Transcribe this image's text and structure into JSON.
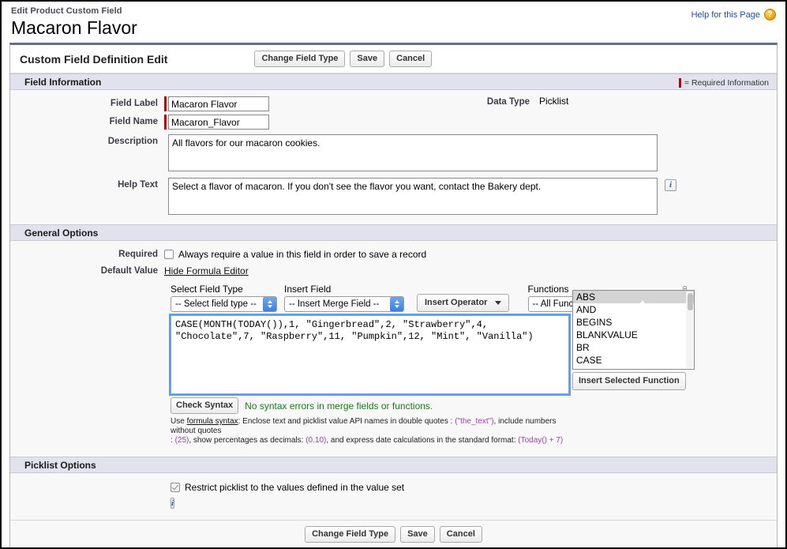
{
  "masthead": {
    "breadcrumb": "Edit Product Custom Field",
    "title": "Macaron Flavor",
    "help_link": "Help for this Page",
    "help_badge": "?"
  },
  "panel": {
    "title": "Custom Field Definition Edit",
    "buttons": {
      "change_field_type": "Change Field Type",
      "save": "Save",
      "cancel": "Cancel"
    }
  },
  "field_information": {
    "section_title": "Field Information",
    "required_legend": "= Required Information",
    "field_label": {
      "label": "Field Label",
      "value": "Macaron Flavor"
    },
    "field_name": {
      "label": "Field Name",
      "value": "Macaron_Flavor"
    },
    "description": {
      "label": "Description",
      "value": "All flavors for our macaron cookies."
    },
    "help_text": {
      "label": "Help Text",
      "value": "Select a flavor of macaron. If you don't see the flavor you want, contact the Bakery dept."
    },
    "data_type": {
      "label": "Data Type",
      "value": "Picklist"
    },
    "info_icon": "i"
  },
  "general_options": {
    "section_title": "General Options",
    "required": {
      "label": "Required",
      "checkbox_text": "Always require a value in this field in order to save a record",
      "checked": false
    },
    "default_value": {
      "label": "Default Value",
      "toggle_link": "Hide Formula Editor"
    },
    "formula_editor": {
      "select_field_type_label": "Select Field Type",
      "select_field_type_value": "-- Select field type --",
      "insert_field_label": "Insert Field",
      "insert_field_value": "-- Insert Merge Field --",
      "insert_operator_button": "Insert Operator",
      "functions_label": "Functions",
      "function_category_value": "-- All Function Categorie",
      "function_list": [
        "ABS",
        "AND",
        "BEGINS",
        "BLANKVALUE",
        "BR",
        "CASE"
      ],
      "function_selected": "ABS",
      "insert_selected_function_button": "Insert Selected Function",
      "formula_text": "CASE(MONTH(TODAY()),1, \"Gingerbread\",2, \"Strawberry\",4, \"Chocolate\",7, \"Raspberry\",11, \"Pumpkin\",12, \"Mint\", \"Vanilla\")",
      "check_syntax_button": "Check Syntax",
      "syntax_message": "No syntax errors in merge fields or functions.",
      "help_line1_a": "Use ",
      "help_line1_link": "formula syntax",
      "help_line1_b": ": Enclose text and picklist value API names in double quotes : ",
      "help_line1_code1": "(\"the_text\")",
      "help_line1_c": ", include numbers without quotes",
      "help_line2_a": ": ",
      "help_line2_code1": "(25)",
      "help_line2_b": ", show percentages as decimals: ",
      "help_line2_code2": "(0.10)",
      "help_line2_c": ", and express date calculations in the standard format: ",
      "help_line2_code3": "(Today() + 7)",
      "info_icon": "i"
    }
  },
  "picklist_options": {
    "section_title": "Picklist Options",
    "restrict": {
      "text": "Restrict picklist to the values defined in the value set",
      "checked": true
    },
    "info_icon": "i"
  },
  "footer": {
    "change_field_type": "Change Field Type",
    "save": "Save",
    "cancel": "Cancel"
  },
  "colors": {
    "required_red": "#c00000",
    "section_bar": "#e2e2ee",
    "panel_top_rule": "#636d8c",
    "link_blue": "#1b4f9c",
    "success_green": "#1b7a1b",
    "code_mauve": "#a03fb0",
    "select_arrow_blue": "#3d7fe0"
  }
}
